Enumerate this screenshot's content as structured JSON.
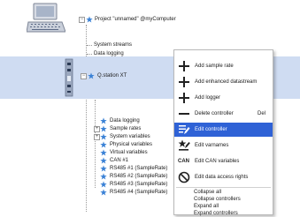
{
  "tree": {
    "project_label": "Project \"unnamed\" @myComputer",
    "top_items": [
      "System streams",
      "Data logging"
    ],
    "station_label": "Q.station XT",
    "children": [
      "Data logging",
      "Sample rates",
      "System variables",
      "Physical variables",
      "Virtual variables",
      "CAN #1",
      "RS485 #1 (SampleRate)",
      "RS485 #2 (SampleRate)",
      "RS485 #3 (SampleRate)",
      "RS485 #4 (SampleRate)"
    ]
  },
  "context_menu": {
    "items": [
      {
        "label": "Add sample rate",
        "icon": "plus-icon"
      },
      {
        "label": "Add enhanced datastream",
        "icon": "plus-icon"
      },
      {
        "label": "Add logger",
        "icon": "plus-icon"
      },
      {
        "label": "Delete controller",
        "icon": "minus-icon",
        "shortcut": "Del"
      },
      {
        "label": "Edit controller",
        "icon": "edit-controller-icon",
        "highlighted": true
      },
      {
        "label": "Edit varnames",
        "icon": "edit-varnames-icon"
      },
      {
        "label": "Edit CAN variables",
        "icon": "can-icon",
        "icon_text": "CAN"
      },
      {
        "label": "Edit data access rights",
        "icon": "no-access-icon"
      }
    ],
    "plain_items": [
      "Collapse all",
      "Collapse controllers",
      "Expand all",
      "Expand controllers"
    ]
  },
  "colors": {
    "highlight": "#2f62d6",
    "selection_band": "#cfdcf2",
    "star": "#3b82d6",
    "station_icon": "#e58a8a"
  }
}
